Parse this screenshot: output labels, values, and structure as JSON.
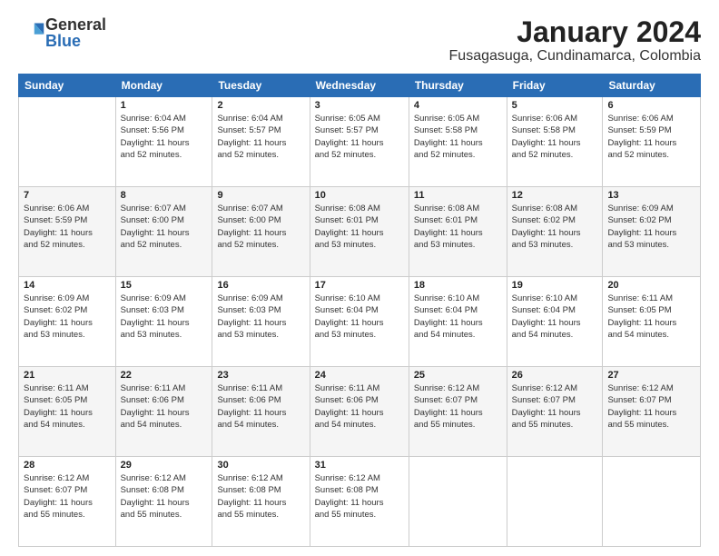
{
  "header": {
    "logo_general": "General",
    "logo_blue": "Blue",
    "month_title": "January 2024",
    "location": "Fusagasuga, Cundinamarca, Colombia"
  },
  "days_of_week": [
    "Sunday",
    "Monday",
    "Tuesday",
    "Wednesday",
    "Thursday",
    "Friday",
    "Saturday"
  ],
  "weeks": [
    [
      {
        "day": "",
        "info": ""
      },
      {
        "day": "1",
        "info": "Sunrise: 6:04 AM\nSunset: 5:56 PM\nDaylight: 11 hours\nand 52 minutes."
      },
      {
        "day": "2",
        "info": "Sunrise: 6:04 AM\nSunset: 5:57 PM\nDaylight: 11 hours\nand 52 minutes."
      },
      {
        "day": "3",
        "info": "Sunrise: 6:05 AM\nSunset: 5:57 PM\nDaylight: 11 hours\nand 52 minutes."
      },
      {
        "day": "4",
        "info": "Sunrise: 6:05 AM\nSunset: 5:58 PM\nDaylight: 11 hours\nand 52 minutes."
      },
      {
        "day": "5",
        "info": "Sunrise: 6:06 AM\nSunset: 5:58 PM\nDaylight: 11 hours\nand 52 minutes."
      },
      {
        "day": "6",
        "info": "Sunrise: 6:06 AM\nSunset: 5:59 PM\nDaylight: 11 hours\nand 52 minutes."
      }
    ],
    [
      {
        "day": "7",
        "info": "Sunrise: 6:06 AM\nSunset: 5:59 PM\nDaylight: 11 hours\nand 52 minutes."
      },
      {
        "day": "8",
        "info": "Sunrise: 6:07 AM\nSunset: 6:00 PM\nDaylight: 11 hours\nand 52 minutes."
      },
      {
        "day": "9",
        "info": "Sunrise: 6:07 AM\nSunset: 6:00 PM\nDaylight: 11 hours\nand 52 minutes."
      },
      {
        "day": "10",
        "info": "Sunrise: 6:08 AM\nSunset: 6:01 PM\nDaylight: 11 hours\nand 53 minutes."
      },
      {
        "day": "11",
        "info": "Sunrise: 6:08 AM\nSunset: 6:01 PM\nDaylight: 11 hours\nand 53 minutes."
      },
      {
        "day": "12",
        "info": "Sunrise: 6:08 AM\nSunset: 6:02 PM\nDaylight: 11 hours\nand 53 minutes."
      },
      {
        "day": "13",
        "info": "Sunrise: 6:09 AM\nSunset: 6:02 PM\nDaylight: 11 hours\nand 53 minutes."
      }
    ],
    [
      {
        "day": "14",
        "info": "Sunrise: 6:09 AM\nSunset: 6:02 PM\nDaylight: 11 hours\nand 53 minutes."
      },
      {
        "day": "15",
        "info": "Sunrise: 6:09 AM\nSunset: 6:03 PM\nDaylight: 11 hours\nand 53 minutes."
      },
      {
        "day": "16",
        "info": "Sunrise: 6:09 AM\nSunset: 6:03 PM\nDaylight: 11 hours\nand 53 minutes."
      },
      {
        "day": "17",
        "info": "Sunrise: 6:10 AM\nSunset: 6:04 PM\nDaylight: 11 hours\nand 53 minutes."
      },
      {
        "day": "18",
        "info": "Sunrise: 6:10 AM\nSunset: 6:04 PM\nDaylight: 11 hours\nand 54 minutes."
      },
      {
        "day": "19",
        "info": "Sunrise: 6:10 AM\nSunset: 6:04 PM\nDaylight: 11 hours\nand 54 minutes."
      },
      {
        "day": "20",
        "info": "Sunrise: 6:11 AM\nSunset: 6:05 PM\nDaylight: 11 hours\nand 54 minutes."
      }
    ],
    [
      {
        "day": "21",
        "info": "Sunrise: 6:11 AM\nSunset: 6:05 PM\nDaylight: 11 hours\nand 54 minutes."
      },
      {
        "day": "22",
        "info": "Sunrise: 6:11 AM\nSunset: 6:06 PM\nDaylight: 11 hours\nand 54 minutes."
      },
      {
        "day": "23",
        "info": "Sunrise: 6:11 AM\nSunset: 6:06 PM\nDaylight: 11 hours\nand 54 minutes."
      },
      {
        "day": "24",
        "info": "Sunrise: 6:11 AM\nSunset: 6:06 PM\nDaylight: 11 hours\nand 54 minutes."
      },
      {
        "day": "25",
        "info": "Sunrise: 6:12 AM\nSunset: 6:07 PM\nDaylight: 11 hours\nand 55 minutes."
      },
      {
        "day": "26",
        "info": "Sunrise: 6:12 AM\nSunset: 6:07 PM\nDaylight: 11 hours\nand 55 minutes."
      },
      {
        "day": "27",
        "info": "Sunrise: 6:12 AM\nSunset: 6:07 PM\nDaylight: 11 hours\nand 55 minutes."
      }
    ],
    [
      {
        "day": "28",
        "info": "Sunrise: 6:12 AM\nSunset: 6:07 PM\nDaylight: 11 hours\nand 55 minutes."
      },
      {
        "day": "29",
        "info": "Sunrise: 6:12 AM\nSunset: 6:08 PM\nDaylight: 11 hours\nand 55 minutes."
      },
      {
        "day": "30",
        "info": "Sunrise: 6:12 AM\nSunset: 6:08 PM\nDaylight: 11 hours\nand 55 minutes."
      },
      {
        "day": "31",
        "info": "Sunrise: 6:12 AM\nSunset: 6:08 PM\nDaylight: 11 hours\nand 55 minutes."
      },
      {
        "day": "",
        "info": ""
      },
      {
        "day": "",
        "info": ""
      },
      {
        "day": "",
        "info": ""
      }
    ]
  ]
}
